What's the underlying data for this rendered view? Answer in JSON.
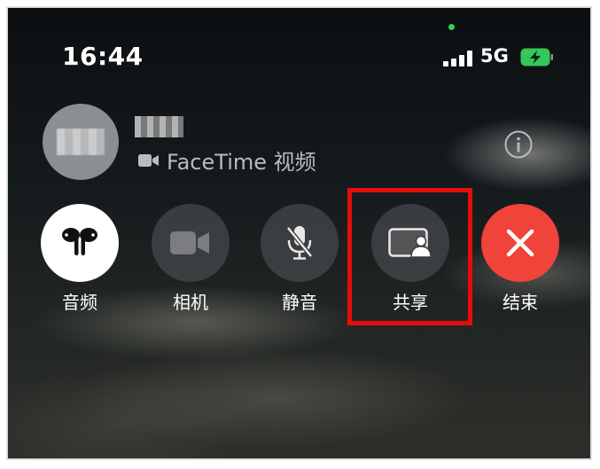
{
  "status_bar": {
    "time": "16:44",
    "network": "5G"
  },
  "caller": {
    "call_type": "FaceTime 视频"
  },
  "controls": [
    {
      "label": "音频"
    },
    {
      "label": "相机"
    },
    {
      "label": "静音"
    },
    {
      "label": "共享"
    },
    {
      "label": "结束"
    }
  ],
  "colors": {
    "end_call": "#f0433a",
    "privacy_dot": "#2fd158",
    "highlight_box": "#e60c0c"
  }
}
